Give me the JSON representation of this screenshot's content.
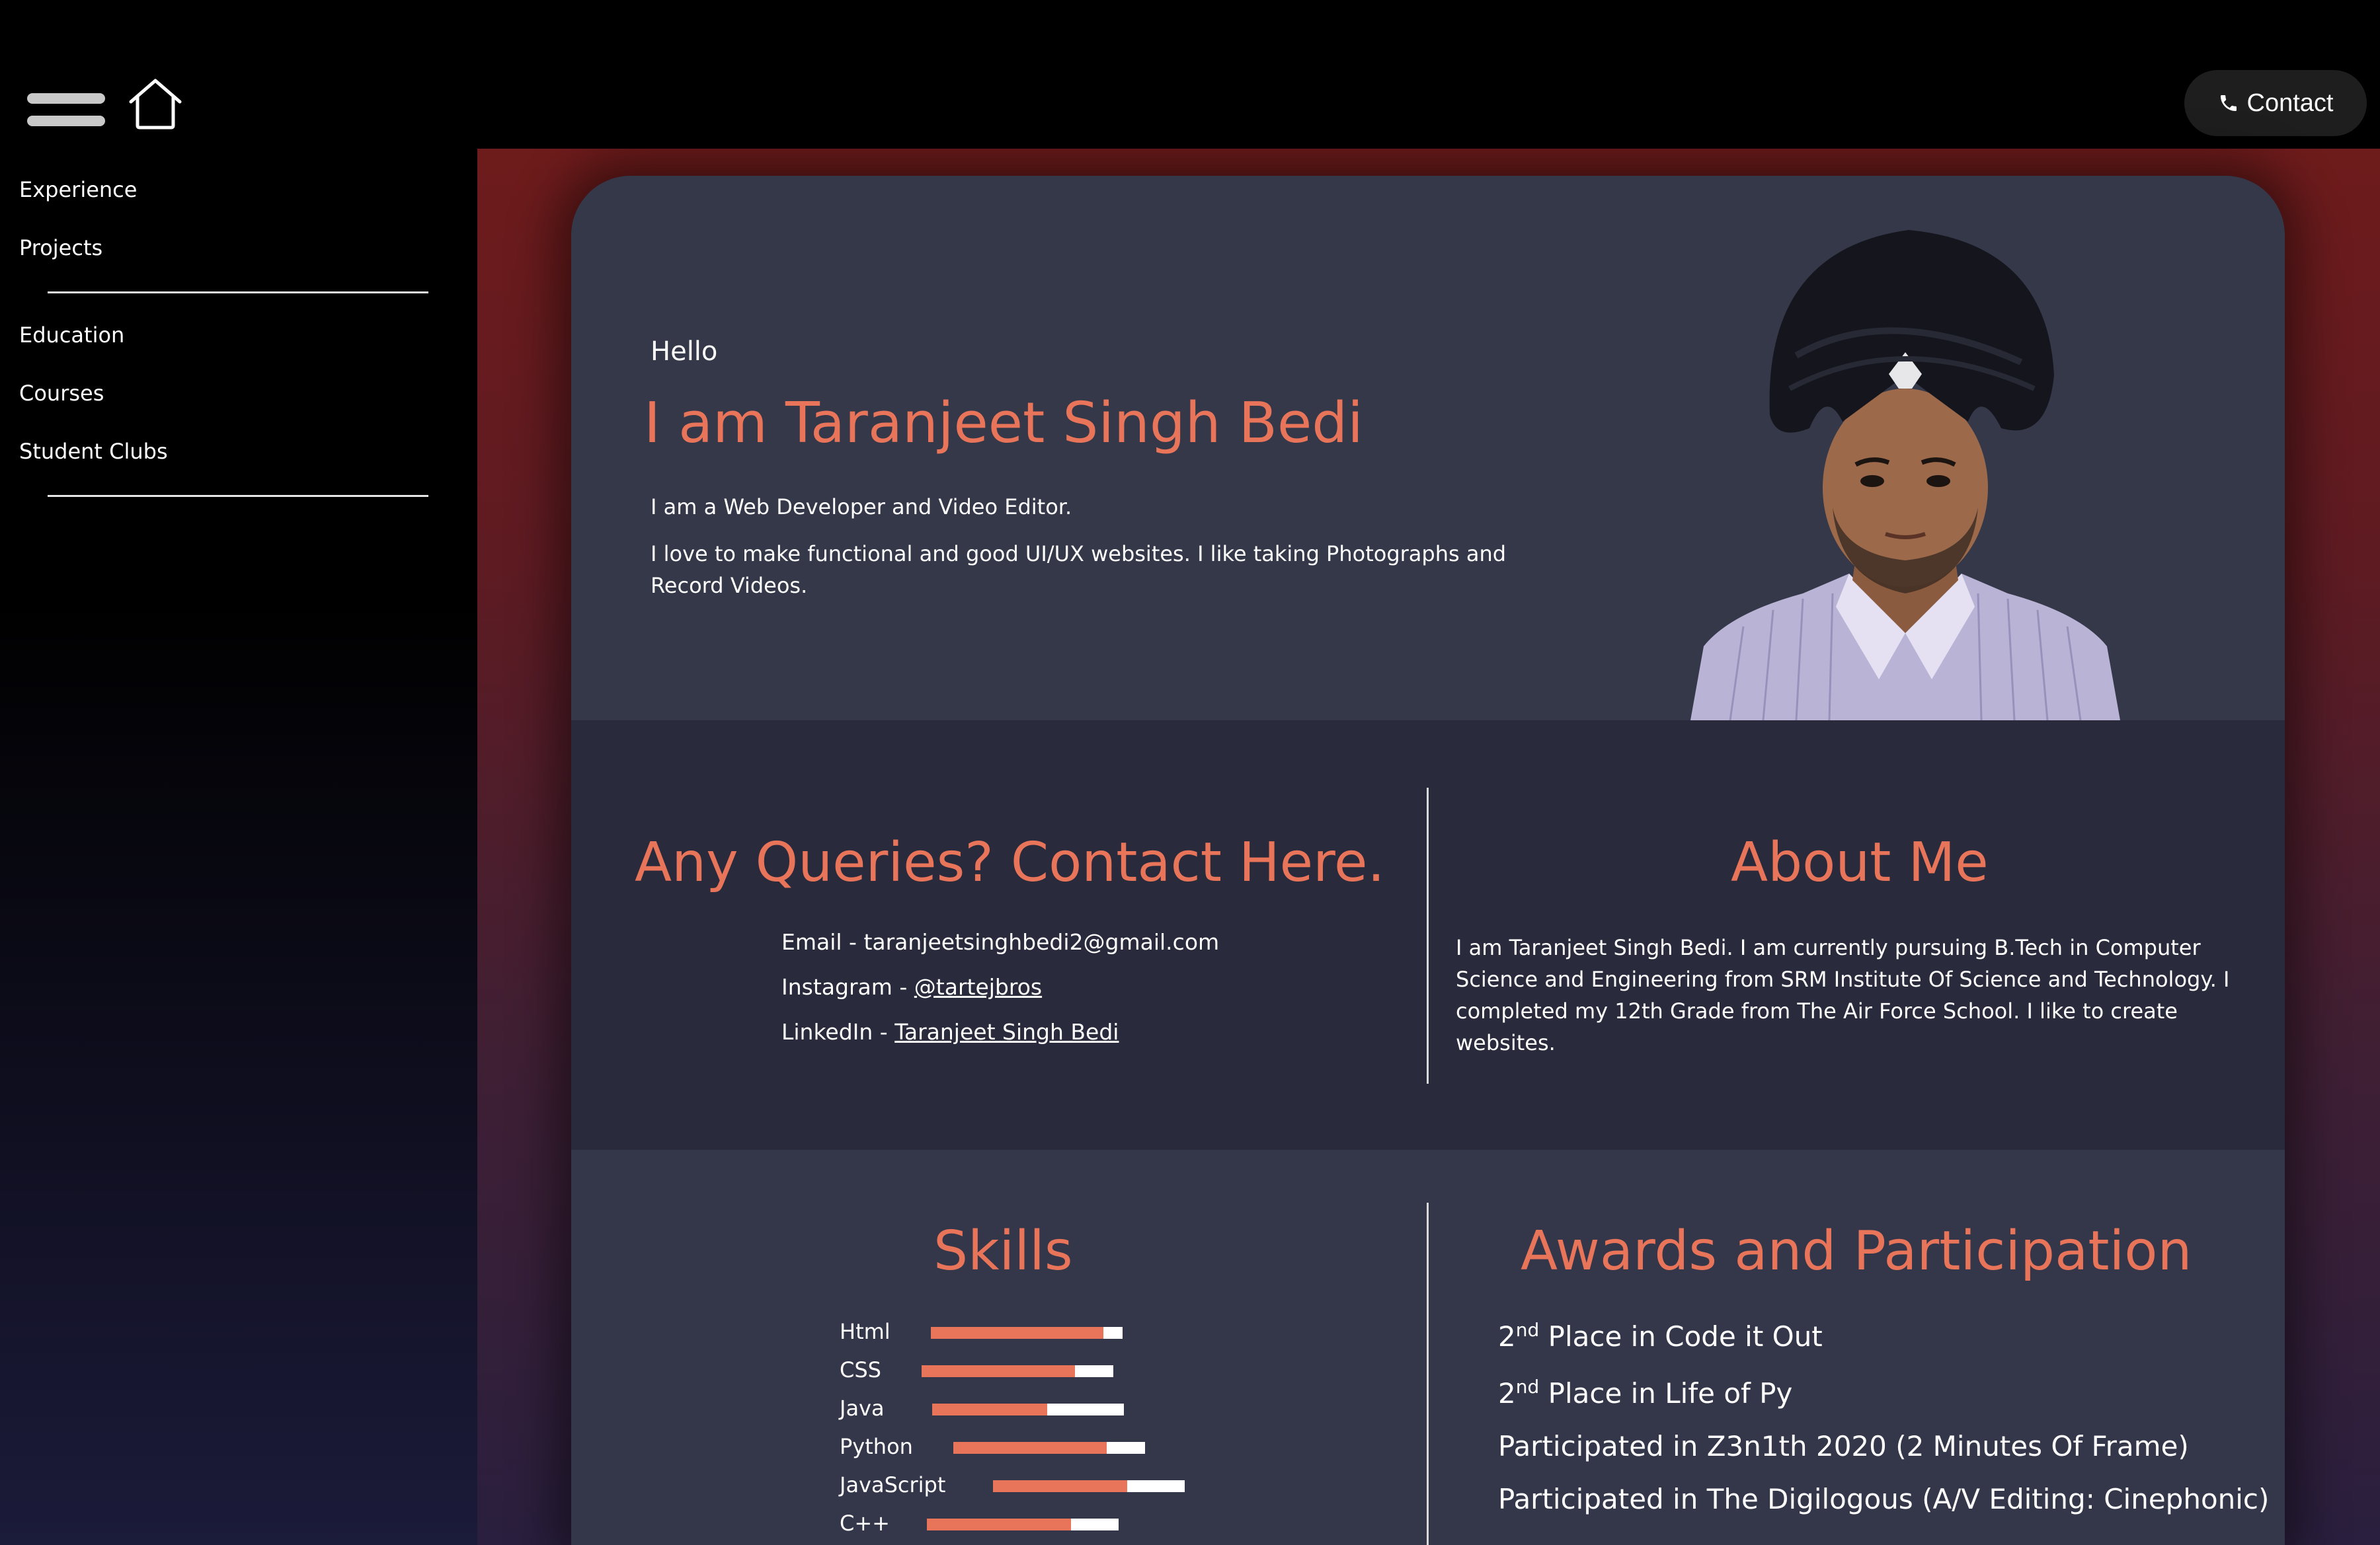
{
  "topbar": {
    "contact_label": "Contact"
  },
  "sidebar": {
    "items": [
      "Experience",
      "Projects",
      "Education",
      "Courses",
      "Student Clubs"
    ]
  },
  "hero": {
    "greeting": "Hello",
    "name": "I am Taranjeet Singh Bedi",
    "line1": "I am a Web Developer and Video Editor.",
    "line2": "I love to make functional and good UI/UX websites. I like taking Photographs and Record Videos."
  },
  "contact": {
    "heading": "Any Queries? Contact Here.",
    "email_prefix": "Email - ",
    "email": "taranjeetsinghbedi2@gmail.com",
    "instagram_prefix": "Instagram - ",
    "instagram": "@tartejbros",
    "linkedin_prefix": "LinkedIn - ",
    "linkedin": "Taranjeet Singh Bedi"
  },
  "about": {
    "heading": "About Me",
    "text": "I am Taranjeet Singh Bedi. I am currently pursuing B.Tech in Computer Science and Engineering from SRM Institute Of Science and Technology. I completed my 12th Grade from The Air Force School. I like to create websites."
  },
  "skills": {
    "heading": "Skills",
    "items": [
      {
        "name": "Html",
        "level": 0.9
      },
      {
        "name": "CSS",
        "level": 0.8
      },
      {
        "name": "Java",
        "level": 0.6
      },
      {
        "name": "Python",
        "level": 0.8
      },
      {
        "name": "JavaScript",
        "level": 0.7
      },
      {
        "name": "C++",
        "level": 0.75
      }
    ]
  },
  "awards": {
    "heading": "Awards and Participation",
    "items": [
      {
        "sup": "nd",
        "pre": "2",
        "text": " Place in Code it Out"
      },
      {
        "sup": "nd",
        "pre": "2",
        "text": " Place in Life of Py"
      },
      {
        "sup": "",
        "pre": "",
        "text": "Participated in Z3n1th 2020 (2 Minutes Of Frame)"
      },
      {
        "sup": "",
        "pre": "",
        "text": "Participated in The Digilogous (A/V Editing: Cinephonic)"
      }
    ]
  },
  "colors": {
    "accent": "#e8745a",
    "card": "#353849",
    "card_dark": "#292a3b"
  }
}
